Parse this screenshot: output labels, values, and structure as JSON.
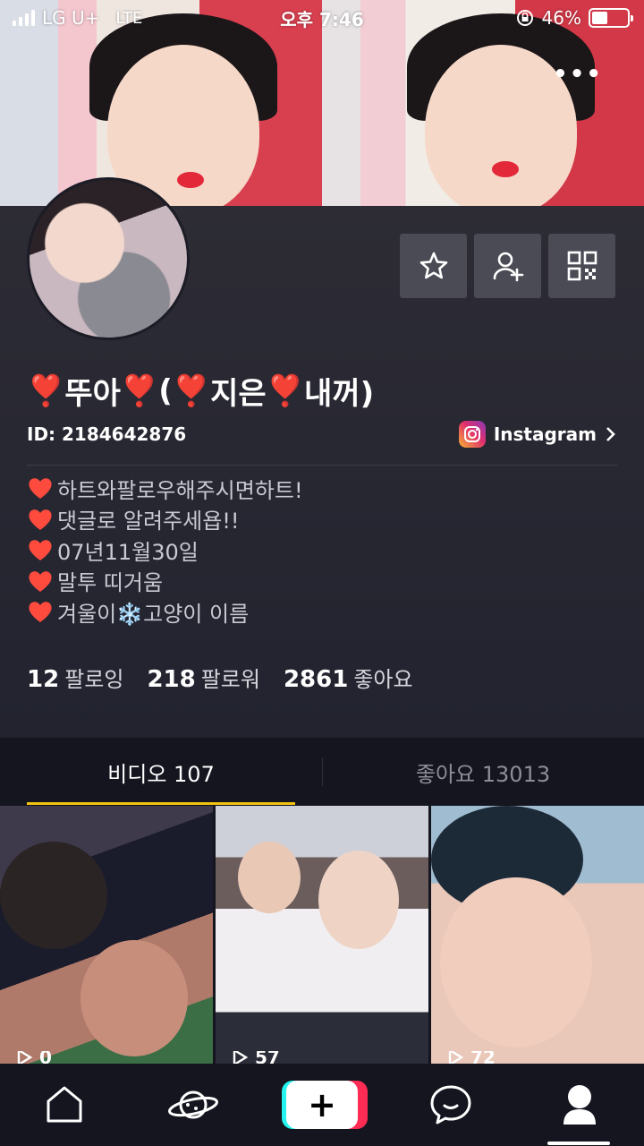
{
  "status_bar": {
    "carrier": "LG U+",
    "network": "LTE",
    "time": "오후 7:46",
    "battery_percent": "46%",
    "battery_level": 0.46
  },
  "profile": {
    "username": "뚜아 ( 지은 내꺼)",
    "username_parts": [
      "❣️",
      "뚜아",
      "❣️",
      "(",
      "❣️",
      "지은",
      "❣️",
      "내꺼)"
    ],
    "id_label": "ID: 2184642876",
    "instagram_label": "Instagram",
    "bio_lines": [
      "하트와팔로우해주시면하트!",
      "댓글로 알려주세욥!!",
      "07년11월30일",
      "말투 띠거움",
      "겨울이❄️고양이 이름"
    ],
    "stats": {
      "following_count": "12",
      "following_label": "팔로잉",
      "followers_count": "218",
      "followers_label": "팔로워",
      "likes_count": "2861",
      "likes_label": "좋아요"
    }
  },
  "tabs": {
    "videos": "비디오 107",
    "liked": "좋아요 13013"
  },
  "grid": [
    {
      "plays": "0"
    },
    {
      "plays": "57"
    },
    {
      "plays": "72"
    }
  ],
  "icons": {
    "favorite": "star-icon",
    "add_friend": "person-add-icon",
    "qr": "qr-code-icon",
    "home": "home-icon",
    "discover": "planet-icon",
    "inbox": "chat-bubble-icon",
    "me": "profile-icon"
  },
  "colors": {
    "accent_tab": "#f2c311",
    "create_cyan": "#25f4ee",
    "create_red": "#fe2c55"
  }
}
